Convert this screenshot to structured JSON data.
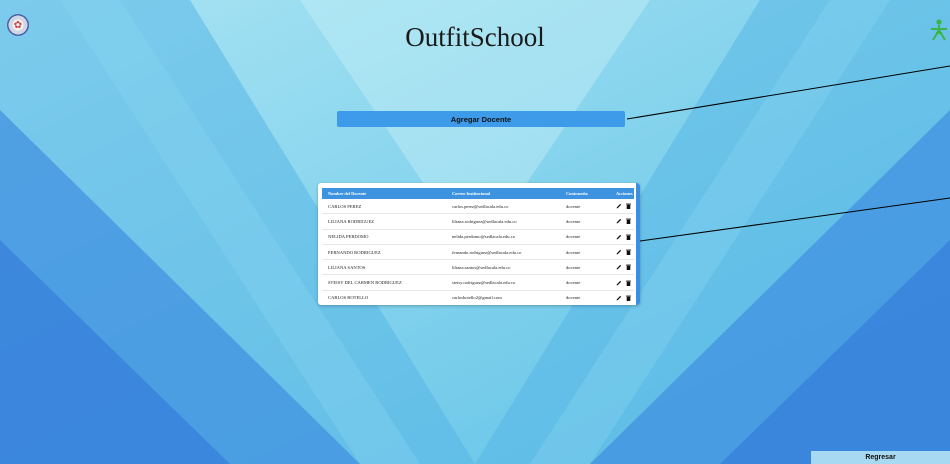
{
  "app": {
    "title": "OutfitSchool"
  },
  "icons": {
    "left_logo": "school-crest-icon",
    "right_logo": "sena-logo-icon",
    "edit": "pencil-icon",
    "delete": "trash-icon"
  },
  "colors": {
    "primary_button": "#3d9be9",
    "table_header": "#3d93df",
    "return_button": "#a7d9f2"
  },
  "actions": {
    "add_teacher_label": "Agregar Docente",
    "return_label": "Regresar"
  },
  "table": {
    "headers": {
      "name": "Nombre del Docente",
      "email": "Correo Institucional",
      "password": "Contraseña",
      "actions": "Acciones"
    },
    "rows": [
      {
        "name": "CARLOS PEREZ",
        "email": "carlos.perez@sedlacala.edu.co",
        "password": "docente"
      },
      {
        "name": "LILIANA RODRIGUEZ",
        "email": "liliana.rodriguez@sedlacala.edu.co",
        "password": "docente"
      },
      {
        "name": "NELIDA PERDOMO",
        "email": "nelida.perdomo@sedlacala.edu.co",
        "password": "docente"
      },
      {
        "name": "FERNANDO RODRIGUEZ",
        "email": "fernando.rodriguez@sedlacala.edu.co",
        "password": "docente"
      },
      {
        "name": "LILIANA SANTOS",
        "email": "liliana.santos@sedlacala.edu.co",
        "password": "docente"
      },
      {
        "name": "STEISY DEL CARMEN RODRIGUEZ",
        "email": "steisy.rodriguez@sedlacala.edu.co",
        "password": "docente"
      },
      {
        "name": "CARLOS BOTELLO",
        "email": "carlosbotello2@gmail.com",
        "password": "docente"
      }
    ]
  }
}
